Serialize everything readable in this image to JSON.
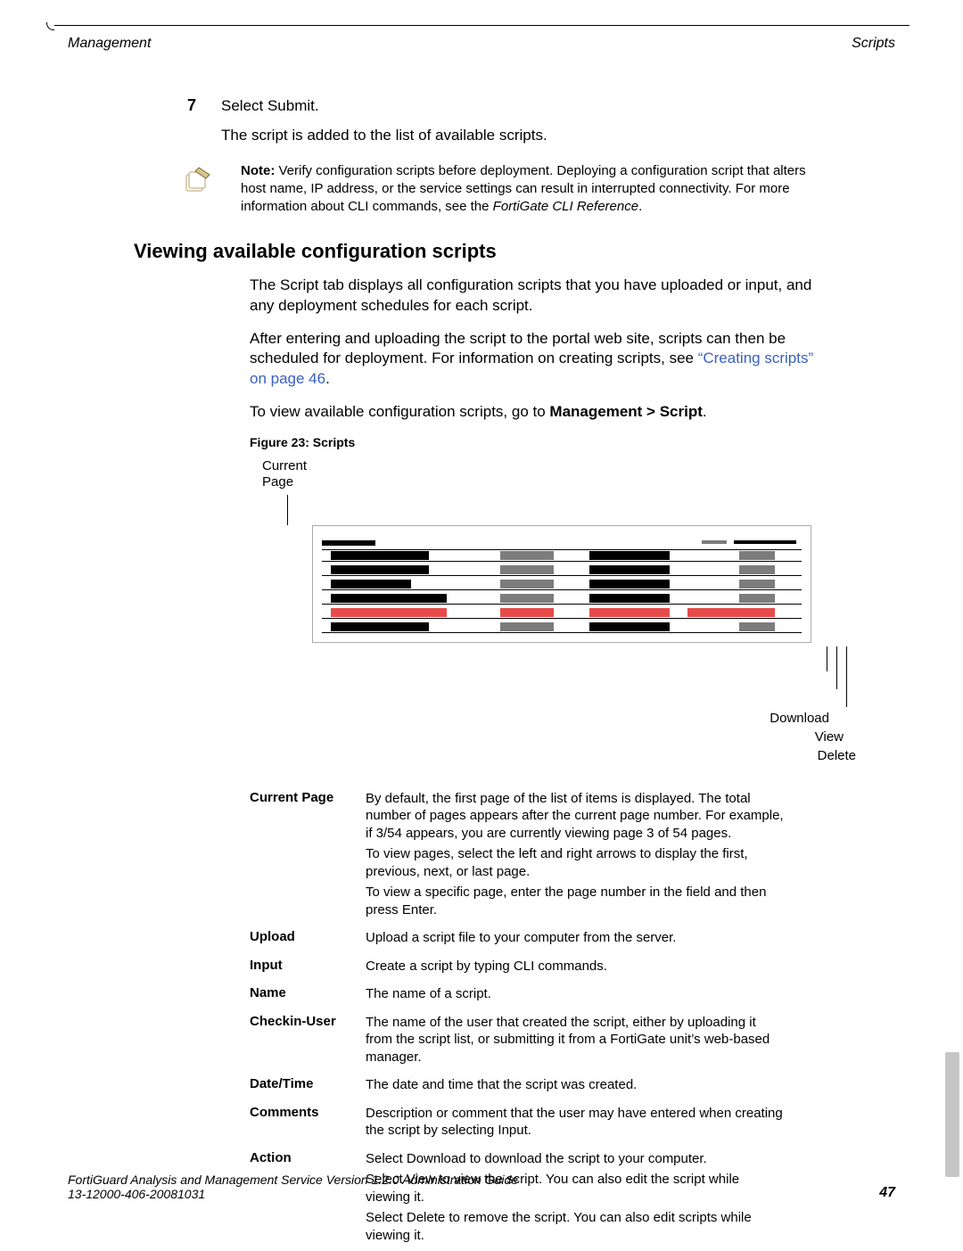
{
  "header": {
    "left": "Management",
    "right": "Scripts"
  },
  "step": {
    "num": "7",
    "line1": "Select Submit.",
    "line2": "The script is added to the list of available scripts."
  },
  "note": {
    "label": "Note:",
    "body": " Verify configuration scripts before deployment. Deploying a configuration script that alters host name, IP address, or the service settings can result in interrupted connectivity. For more information about CLI commands, see the ",
    "ref": "FortiGate CLI Reference",
    "tail": "."
  },
  "section_title": "Viewing available configuration scripts",
  "para1": "The Script tab displays all configuration scripts that you have uploaded or input, and any deployment schedules for each script.",
  "para2a": "After entering and uploading the script to the portal web site, scripts can then be scheduled for deployment. For information on creating scripts, see ",
  "para2_link": "“Creating scripts” on page 46",
  "para2b": ".",
  "para3a": "To view available configuration scripts, go to ",
  "para3b": "Management > Script",
  "para3c": ".",
  "figure_caption": "Figure 23: Scripts",
  "callout_top_l1": "Current",
  "callout_top_l2": "Page",
  "callout_download": "Download",
  "callout_view": "View",
  "callout_delete": "Delete",
  "defs": [
    {
      "term": "Current Page",
      "desc": [
        "By default, the first page of the list of items is displayed. The total number of pages appears after the current page number. For example, if 3/54 appears, you are currently viewing page 3 of 54 pages.",
        "To view pages, select the left and right arrows to display the first, previous, next, or last page.",
        "To view a specific page, enter the page number in the field and then press Enter."
      ]
    },
    {
      "term": "Upload",
      "desc": [
        "Upload a script file to your computer from the server."
      ]
    },
    {
      "term": "Input",
      "desc": [
        "Create a script by typing CLI commands."
      ]
    },
    {
      "term": "Name",
      "desc": [
        "The name of a script."
      ]
    },
    {
      "term": "Checkin-User",
      "desc": [
        "The name of the user that created the script, either by uploading it from the script list, or submitting it from a FortiGate unit’s web-based manager."
      ]
    },
    {
      "term": "Date/Time",
      "desc": [
        "The date and time that the script was created."
      ]
    },
    {
      "term": "Comments",
      "desc": [
        "Description or comment that the user may have entered when creating the script by selecting Input."
      ]
    },
    {
      "term": "Action",
      "desc": [
        "Select Download to download the script to your computer.",
        "Select View to view the script. You can also edit the script while viewing it.",
        "Select Delete to remove the script. You can also edit scripts while viewing it."
      ]
    }
  ],
  "footer": {
    "line1": "FortiGuard Analysis and Management Service Version 1.2.0 Administration Guide",
    "line2": "13-12000-406-20081031",
    "page": "47"
  }
}
